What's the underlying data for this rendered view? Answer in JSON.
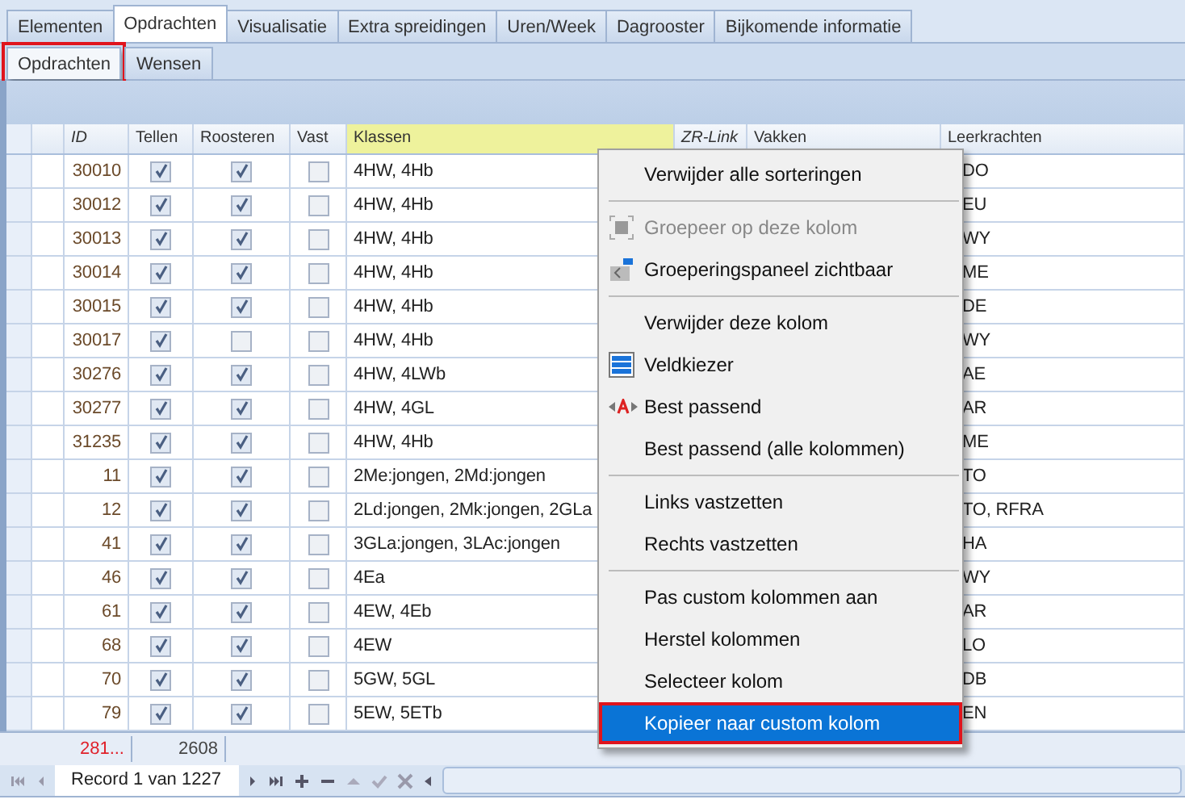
{
  "tabs": [
    {
      "label": "Elementen",
      "selected": false
    },
    {
      "label": "Opdrachten",
      "selected": true
    },
    {
      "label": "Visualisatie",
      "selected": false
    },
    {
      "label": "Extra spreidingen",
      "selected": false
    },
    {
      "label": "Uren/Week",
      "selected": false
    },
    {
      "label": "Dagrooster",
      "selected": false
    },
    {
      "label": "Bijkomende informatie",
      "selected": false
    }
  ],
  "subtabs": [
    {
      "label": "Opdrachten",
      "selected": true,
      "annotated": true
    },
    {
      "label": "Wensen",
      "selected": false,
      "annotated": false
    }
  ],
  "grid": {
    "columns": [
      {
        "label": "ID",
        "italic": true,
        "highlighted": false
      },
      {
        "label": "Tellen",
        "italic": false,
        "highlighted": false
      },
      {
        "label": "Roosteren",
        "italic": false,
        "highlighted": false
      },
      {
        "label": "Vast",
        "italic": false,
        "highlighted": false
      },
      {
        "label": "Klassen",
        "italic": false,
        "highlighted": true
      },
      {
        "label": "ZR-Link",
        "italic": true,
        "highlighted": false
      },
      {
        "label": "Vakken",
        "italic": false,
        "highlighted": false
      },
      {
        "label": "Leerkrachten",
        "italic": false,
        "highlighted": false
      }
    ],
    "rows": [
      {
        "id": "30010",
        "tellen": true,
        "roosteren": true,
        "vast": false,
        "klassen": "4HW, 4Hb",
        "leerkrachten": "DO"
      },
      {
        "id": "30012",
        "tellen": true,
        "roosteren": true,
        "vast": false,
        "klassen": "4HW, 4Hb",
        "leerkrachten": "EU"
      },
      {
        "id": "30013",
        "tellen": true,
        "roosteren": true,
        "vast": false,
        "klassen": "4HW, 4Hb",
        "leerkrachten": "WY"
      },
      {
        "id": "30014",
        "tellen": true,
        "roosteren": true,
        "vast": false,
        "klassen": "4HW, 4Hb",
        "leerkrachten": "ME"
      },
      {
        "id": "30015",
        "tellen": true,
        "roosteren": true,
        "vast": false,
        "klassen": "4HW, 4Hb",
        "leerkrachten": "DE"
      },
      {
        "id": "30017",
        "tellen": true,
        "roosteren": false,
        "vast": false,
        "klassen": "4HW, 4Hb",
        "leerkrachten": "WY"
      },
      {
        "id": "30276",
        "tellen": true,
        "roosteren": true,
        "vast": false,
        "klassen": "4HW, 4LWb",
        "leerkrachten": "AE"
      },
      {
        "id": "30277",
        "tellen": true,
        "roosteren": true,
        "vast": false,
        "klassen": "4HW, 4GL",
        "leerkrachten": "AR"
      },
      {
        "id": "31235",
        "tellen": true,
        "roosteren": true,
        "vast": false,
        "klassen": "4HW, 4Hb",
        "leerkrachten": "ME"
      },
      {
        "id": "11",
        "tellen": true,
        "roosteren": true,
        "vast": false,
        "klassen": "2Me:jongen, 2Md:jongen",
        "leerkrachten": "TO"
      },
      {
        "id": "12",
        "tellen": true,
        "roosteren": true,
        "vast": false,
        "klassen": "2Ld:jongen, 2Mk:jongen, 2GLa",
        "leerkrachten": "TO, RFRA"
      },
      {
        "id": "41",
        "tellen": true,
        "roosteren": true,
        "vast": false,
        "klassen": "3GLa:jongen, 3LAc:jongen",
        "leerkrachten": "HA"
      },
      {
        "id": "46",
        "tellen": true,
        "roosteren": true,
        "vast": false,
        "klassen": "4Ea",
        "leerkrachten": "WY"
      },
      {
        "id": "61",
        "tellen": true,
        "roosteren": true,
        "vast": false,
        "klassen": "4EW, 4Eb",
        "leerkrachten": "AR"
      },
      {
        "id": "68",
        "tellen": true,
        "roosteren": true,
        "vast": false,
        "klassen": "4EW",
        "leerkrachten": "LO"
      },
      {
        "id": "70",
        "tellen": true,
        "roosteren": true,
        "vast": false,
        "klassen": "5GW, 5GL",
        "leerkrachten": "DB"
      },
      {
        "id": "79",
        "tellen": true,
        "roosteren": true,
        "vast": false,
        "klassen": "5EW, 5ETb",
        "leerkrachten": "EN"
      }
    ],
    "summary": {
      "id_total": "281...",
      "roosteren_total": "2608"
    }
  },
  "navigator": {
    "record": "Record 1 van 1227"
  },
  "context_menu": [
    {
      "kind": "plain",
      "label": "Verwijder alle sorteringen",
      "disabled": false,
      "selected": false,
      "annotated": false
    },
    {
      "kind": "separator"
    },
    {
      "kind": "group",
      "label": "Groepeer op deze kolom",
      "disabled": true,
      "selected": false,
      "annotated": false
    },
    {
      "kind": "panel",
      "label": "Groeperingspaneel zichtbaar",
      "disabled": false,
      "selected": false,
      "annotated": false
    },
    {
      "kind": "separator"
    },
    {
      "kind": "plain",
      "label": "Verwijder deze kolom",
      "disabled": false,
      "selected": false,
      "annotated": false
    },
    {
      "kind": "columns",
      "label": "Veldkiezer",
      "disabled": false,
      "selected": false,
      "annotated": false
    },
    {
      "kind": "fit",
      "label": "Best passend",
      "disabled": false,
      "selected": false,
      "annotated": false
    },
    {
      "kind": "plain",
      "label": "Best passend (alle kolommen)",
      "disabled": false,
      "selected": false,
      "annotated": false
    },
    {
      "kind": "separator"
    },
    {
      "kind": "plain",
      "label": "Links vastzetten",
      "disabled": false,
      "selected": false,
      "annotated": false
    },
    {
      "kind": "plain",
      "label": "Rechts vastzetten",
      "disabled": false,
      "selected": false,
      "annotated": false
    },
    {
      "kind": "separator"
    },
    {
      "kind": "plain",
      "label": "Pas custom kolommen aan",
      "disabled": false,
      "selected": false,
      "annotated": false
    },
    {
      "kind": "plain",
      "label": "Herstel kolommen",
      "disabled": false,
      "selected": false,
      "annotated": false
    },
    {
      "kind": "plain",
      "label": "Selecteer kolom",
      "disabled": false,
      "selected": false,
      "annotated": false
    },
    {
      "kind": "plain",
      "label": "Kopieer naar custom kolom",
      "disabled": false,
      "selected": true,
      "annotated": true
    }
  ]
}
